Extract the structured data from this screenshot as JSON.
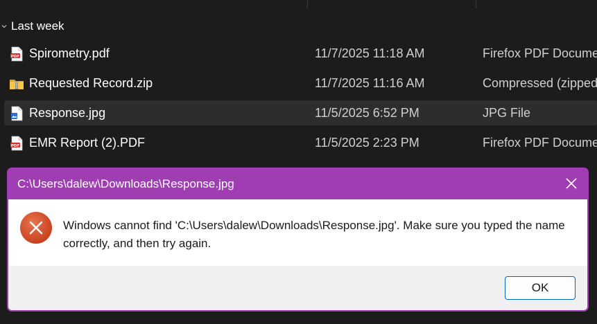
{
  "explorer": {
    "group_label": "Last week",
    "files": [
      {
        "name": "Spirometry.pdf",
        "date": "11/7/2025 11:18 AM",
        "type": "Firefox PDF Document",
        "icon": "pdf-icon"
      },
      {
        "name": "Requested Record.zip",
        "date": "11/7/2025 11:16 AM",
        "type": "Compressed (zipped) Folder",
        "icon": "zip-folder-icon"
      },
      {
        "name": "Response.jpg",
        "date": "11/5/2025 6:52 PM",
        "type": "JPG File",
        "icon": "jpg-image-icon",
        "selected": true
      },
      {
        "name": "EMR Report (2).PDF",
        "date": "11/5/2025 2:23 PM",
        "type": "Firefox PDF Document",
        "icon": "pdf-icon"
      }
    ]
  },
  "dialog": {
    "title": "C:\\Users\\dalew\\Downloads\\Response.jpg",
    "message": "Windows cannot find 'C:\\Users\\dalew\\Downloads\\Response.jpg'. Make sure you typed the name correctly, and then try again.",
    "ok_label": "OK",
    "icon": "error-icon",
    "accent_color": "#a13db3"
  }
}
